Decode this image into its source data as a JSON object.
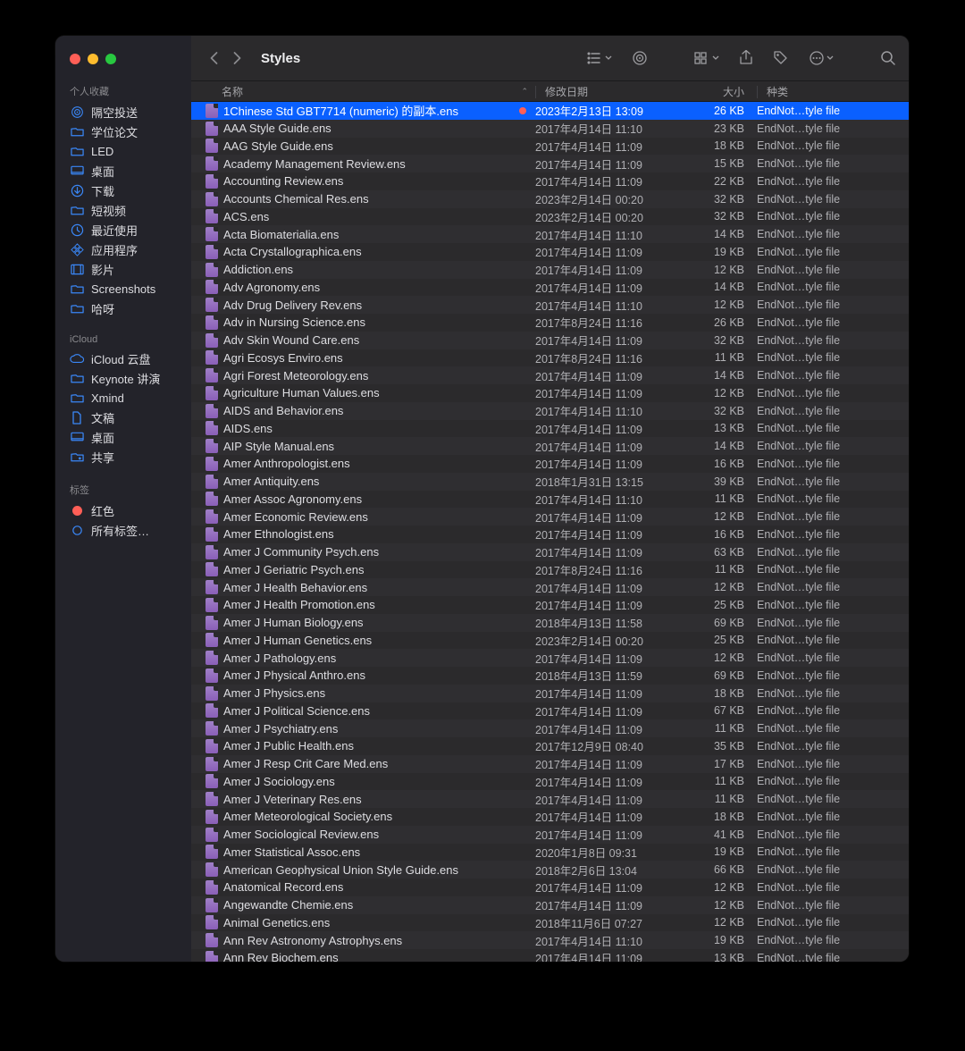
{
  "window_title": "Styles",
  "sidebar": {
    "sections": [
      {
        "label": "个人收藏",
        "items": [
          {
            "icon": "airdrop",
            "label": "隔空投送"
          },
          {
            "icon": "folder",
            "label": "学位论文"
          },
          {
            "icon": "folder",
            "label": "LED"
          },
          {
            "icon": "desktop",
            "label": "桌面"
          },
          {
            "icon": "download",
            "label": "下载"
          },
          {
            "icon": "folder",
            "label": "短视频"
          },
          {
            "icon": "recent",
            "label": "最近使用"
          },
          {
            "icon": "apps",
            "label": "应用程序"
          },
          {
            "icon": "movies",
            "label": "影片"
          },
          {
            "icon": "folder",
            "label": "Screenshots"
          },
          {
            "icon": "folder",
            "label": "哈呀"
          }
        ]
      },
      {
        "label": "iCloud",
        "items": [
          {
            "icon": "cloud",
            "label": "iCloud 云盘"
          },
          {
            "icon": "folder",
            "label": "Keynote 讲演"
          },
          {
            "icon": "folder",
            "label": "Xmind"
          },
          {
            "icon": "doc",
            "label": "文稿"
          },
          {
            "icon": "desktop",
            "label": "桌面"
          },
          {
            "icon": "share",
            "label": "共享"
          }
        ]
      },
      {
        "label": "标签",
        "items": [
          {
            "icon": "dot-red",
            "label": "红色"
          },
          {
            "icon": "tags",
            "label": "所有标签…"
          }
        ]
      }
    ]
  },
  "columns": {
    "name": "名称",
    "date": "修改日期",
    "size": "大小",
    "kind": "种类"
  },
  "files": [
    {
      "name": "1Chinese Std GBT7714 (numeric) 的副本.ens",
      "date": "2023年2月13日 13:09",
      "size": "26 KB",
      "kind": "EndNot…tyle file",
      "selected": true,
      "tag": true
    },
    {
      "name": "AAA Style Guide.ens",
      "date": "2017年4月14日 11:10",
      "size": "23 KB",
      "kind": "EndNot…tyle file"
    },
    {
      "name": "AAG Style Guide.ens",
      "date": "2017年4月14日 11:09",
      "size": "18 KB",
      "kind": "EndNot…tyle file"
    },
    {
      "name": "Academy Management Review.ens",
      "date": "2017年4月14日 11:09",
      "size": "15 KB",
      "kind": "EndNot…tyle file"
    },
    {
      "name": "Accounting Review.ens",
      "date": "2017年4月14日 11:09",
      "size": "22 KB",
      "kind": "EndNot…tyle file"
    },
    {
      "name": "Accounts Chemical Res.ens",
      "date": "2023年2月14日 00:20",
      "size": "32 KB",
      "kind": "EndNot…tyle file"
    },
    {
      "name": "ACS.ens",
      "date": "2023年2月14日 00:20",
      "size": "32 KB",
      "kind": "EndNot…tyle file"
    },
    {
      "name": "Acta Biomaterialia.ens",
      "date": "2017年4月14日 11:10",
      "size": "14 KB",
      "kind": "EndNot…tyle file"
    },
    {
      "name": "Acta Crystallographica.ens",
      "date": "2017年4月14日 11:09",
      "size": "19 KB",
      "kind": "EndNot…tyle file"
    },
    {
      "name": "Addiction.ens",
      "date": "2017年4月14日 11:09",
      "size": "12 KB",
      "kind": "EndNot…tyle file"
    },
    {
      "name": "Adv Agronomy.ens",
      "date": "2017年4月14日 11:09",
      "size": "14 KB",
      "kind": "EndNot…tyle file"
    },
    {
      "name": "Adv Drug Delivery Rev.ens",
      "date": "2017年4月14日 11:10",
      "size": "12 KB",
      "kind": "EndNot…tyle file"
    },
    {
      "name": "Adv in Nursing Science.ens",
      "date": "2017年8月24日 11:16",
      "size": "26 KB",
      "kind": "EndNot…tyle file"
    },
    {
      "name": "Adv Skin Wound Care.ens",
      "date": "2017年4月14日 11:09",
      "size": "32 KB",
      "kind": "EndNot…tyle file"
    },
    {
      "name": "Agri Ecosys Enviro.ens",
      "date": "2017年8月24日 11:16",
      "size": "11 KB",
      "kind": "EndNot…tyle file"
    },
    {
      "name": "Agri Forest Meteorology.ens",
      "date": "2017年4月14日 11:09",
      "size": "14 KB",
      "kind": "EndNot…tyle file"
    },
    {
      "name": "Agriculture Human Values.ens",
      "date": "2017年4月14日 11:09",
      "size": "12 KB",
      "kind": "EndNot…tyle file"
    },
    {
      "name": "AIDS and Behavior.ens",
      "date": "2017年4月14日 11:10",
      "size": "32 KB",
      "kind": "EndNot…tyle file"
    },
    {
      "name": "AIDS.ens",
      "date": "2017年4月14日 11:09",
      "size": "13 KB",
      "kind": "EndNot…tyle file"
    },
    {
      "name": "AIP Style Manual.ens",
      "date": "2017年4月14日 11:09",
      "size": "14 KB",
      "kind": "EndNot…tyle file"
    },
    {
      "name": "Amer Anthropologist.ens",
      "date": "2017年4月14日 11:09",
      "size": "16 KB",
      "kind": "EndNot…tyle file"
    },
    {
      "name": "Amer Antiquity.ens",
      "date": "2018年1月31日 13:15",
      "size": "39 KB",
      "kind": "EndNot…tyle file"
    },
    {
      "name": "Amer Assoc Agronomy.ens",
      "date": "2017年4月14日 11:10",
      "size": "11 KB",
      "kind": "EndNot…tyle file"
    },
    {
      "name": "Amer Economic Review.ens",
      "date": "2017年4月14日 11:09",
      "size": "12 KB",
      "kind": "EndNot…tyle file"
    },
    {
      "name": "Amer Ethnologist.ens",
      "date": "2017年4月14日 11:09",
      "size": "16 KB",
      "kind": "EndNot…tyle file"
    },
    {
      "name": "Amer J Community Psych.ens",
      "date": "2017年4月14日 11:09",
      "size": "63 KB",
      "kind": "EndNot…tyle file"
    },
    {
      "name": "Amer J Geriatric Psych.ens",
      "date": "2017年8月24日 11:16",
      "size": "11 KB",
      "kind": "EndNot…tyle file"
    },
    {
      "name": "Amer J Health Behavior.ens",
      "date": "2017年4月14日 11:09",
      "size": "12 KB",
      "kind": "EndNot…tyle file"
    },
    {
      "name": "Amer J Health Promotion.ens",
      "date": "2017年4月14日 11:09",
      "size": "25 KB",
      "kind": "EndNot…tyle file"
    },
    {
      "name": "Amer J Human Biology.ens",
      "date": "2018年4月13日 11:58",
      "size": "69 KB",
      "kind": "EndNot…tyle file"
    },
    {
      "name": "Amer J Human Genetics.ens",
      "date": "2023年2月14日 00:20",
      "size": "25 KB",
      "kind": "EndNot…tyle file"
    },
    {
      "name": "Amer J Pathology.ens",
      "date": "2017年4月14日 11:09",
      "size": "12 KB",
      "kind": "EndNot…tyle file"
    },
    {
      "name": "Amer J Physical Anthro.ens",
      "date": "2018年4月13日 11:59",
      "size": "69 KB",
      "kind": "EndNot…tyle file"
    },
    {
      "name": "Amer J Physics.ens",
      "date": "2017年4月14日 11:09",
      "size": "18 KB",
      "kind": "EndNot…tyle file"
    },
    {
      "name": "Amer J Political Science.ens",
      "date": "2017年4月14日 11:09",
      "size": "67 KB",
      "kind": "EndNot…tyle file"
    },
    {
      "name": "Amer J Psychiatry.ens",
      "date": "2017年4月14日 11:09",
      "size": "11 KB",
      "kind": "EndNot…tyle file"
    },
    {
      "name": "Amer J Public Health.ens",
      "date": "2017年12月9日 08:40",
      "size": "35 KB",
      "kind": "EndNot…tyle file"
    },
    {
      "name": "Amer J Resp Crit Care Med.ens",
      "date": "2017年4月14日 11:09",
      "size": "17 KB",
      "kind": "EndNot…tyle file"
    },
    {
      "name": "Amer J Sociology.ens",
      "date": "2017年4月14日 11:09",
      "size": "11 KB",
      "kind": "EndNot…tyle file"
    },
    {
      "name": "Amer J Veterinary Res.ens",
      "date": "2017年4月14日 11:09",
      "size": "11 KB",
      "kind": "EndNot…tyle file"
    },
    {
      "name": "Amer Meteorological Society.ens",
      "date": "2017年4月14日 11:09",
      "size": "18 KB",
      "kind": "EndNot…tyle file"
    },
    {
      "name": "Amer Sociological Review.ens",
      "date": "2017年4月14日 11:09",
      "size": "41 KB",
      "kind": "EndNot…tyle file"
    },
    {
      "name": "Amer Statistical Assoc.ens",
      "date": "2020年1月8日 09:31",
      "size": "19 KB",
      "kind": "EndNot…tyle file"
    },
    {
      "name": "American Geophysical Union Style Guide.ens",
      "date": "2018年2月6日 13:04",
      "size": "66 KB",
      "kind": "EndNot…tyle file"
    },
    {
      "name": "Anatomical Record.ens",
      "date": "2017年4月14日 11:09",
      "size": "12 KB",
      "kind": "EndNot…tyle file"
    },
    {
      "name": "Angewandte Chemie.ens",
      "date": "2017年4月14日 11:09",
      "size": "12 KB",
      "kind": "EndNot…tyle file"
    },
    {
      "name": "Animal Genetics.ens",
      "date": "2018年11月6日 07:27",
      "size": "12 KB",
      "kind": "EndNot…tyle file"
    },
    {
      "name": "Ann Rev Astronomy Astrophys.ens",
      "date": "2017年4月14日 11:10",
      "size": "19 KB",
      "kind": "EndNot…tyle file"
    },
    {
      "name": "Ann Rev Biochem.ens",
      "date": "2017年4月14日 11:09",
      "size": "13 KB",
      "kind": "EndNot…tyle file"
    }
  ]
}
